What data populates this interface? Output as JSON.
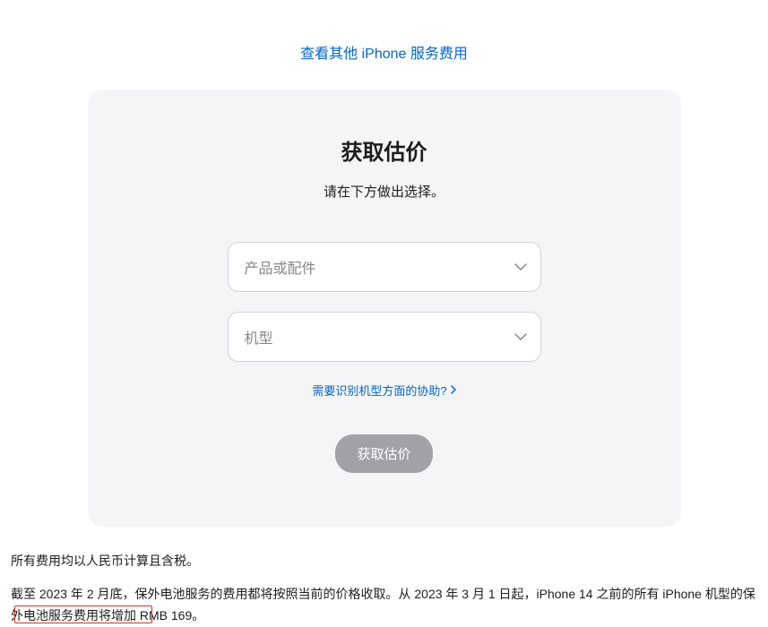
{
  "topLink": {
    "text": "查看其他 iPhone 服务费用"
  },
  "card": {
    "title": "获取估价",
    "subtitle": "请在下方做出选择。",
    "select1": {
      "placeholder": "产品或配件"
    },
    "select2": {
      "placeholder": "机型"
    },
    "helpLink": {
      "text": "需要识别机型方面的协助?"
    },
    "submit": {
      "label": "获取估价"
    }
  },
  "notes": {
    "line1": "所有费用均以人民币计算且含税。",
    "line2": "截至 2023 年 2 月底，保外电池服务的费用都将按照当前的价格收取。从 2023 年 3 月 1 日起，iPhone 14 之前的所有 iPhone 机型的保外电池服务费用将增加 RMB 169。"
  }
}
